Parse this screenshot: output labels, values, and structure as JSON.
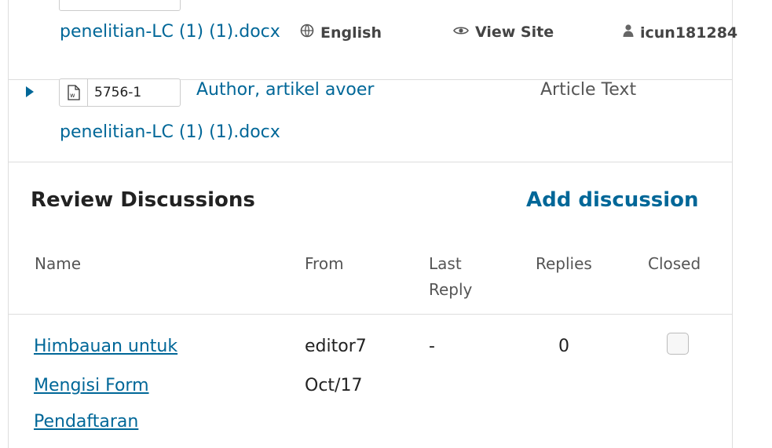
{
  "topbar": {
    "language": "English",
    "view_site": "View Site",
    "username": "icun181284",
    "language_icon": "globe-icon",
    "view_site_icon": "eye-icon",
    "user_icon": "user-icon"
  },
  "files": [
    {
      "name_tail": "penelitian-LC (1) (1).docx"
    },
    {
      "id": "5756-1",
      "name_line1": "Author, artikel avoer",
      "name_line2": "penelitian-LC (1) (1).docx",
      "genre": "Article Text",
      "icon": "word-doc-icon"
    }
  ],
  "review_discussions": {
    "title": "Review Discussions",
    "add_label": "Add discussion",
    "columns": {
      "name": "Name",
      "from": "From",
      "last_reply_1": "Last",
      "last_reply_2": "Reply",
      "replies": "Replies",
      "closed": "Closed"
    },
    "rows": [
      {
        "name_line1": "Himbauan untuk",
        "name_line2": "Mengisi Form",
        "name_line3": "Pendaftaran",
        "from_user": "editor7",
        "from_date": "Oct/17",
        "last_reply": "-",
        "replies": "0",
        "closed": false
      }
    ]
  }
}
